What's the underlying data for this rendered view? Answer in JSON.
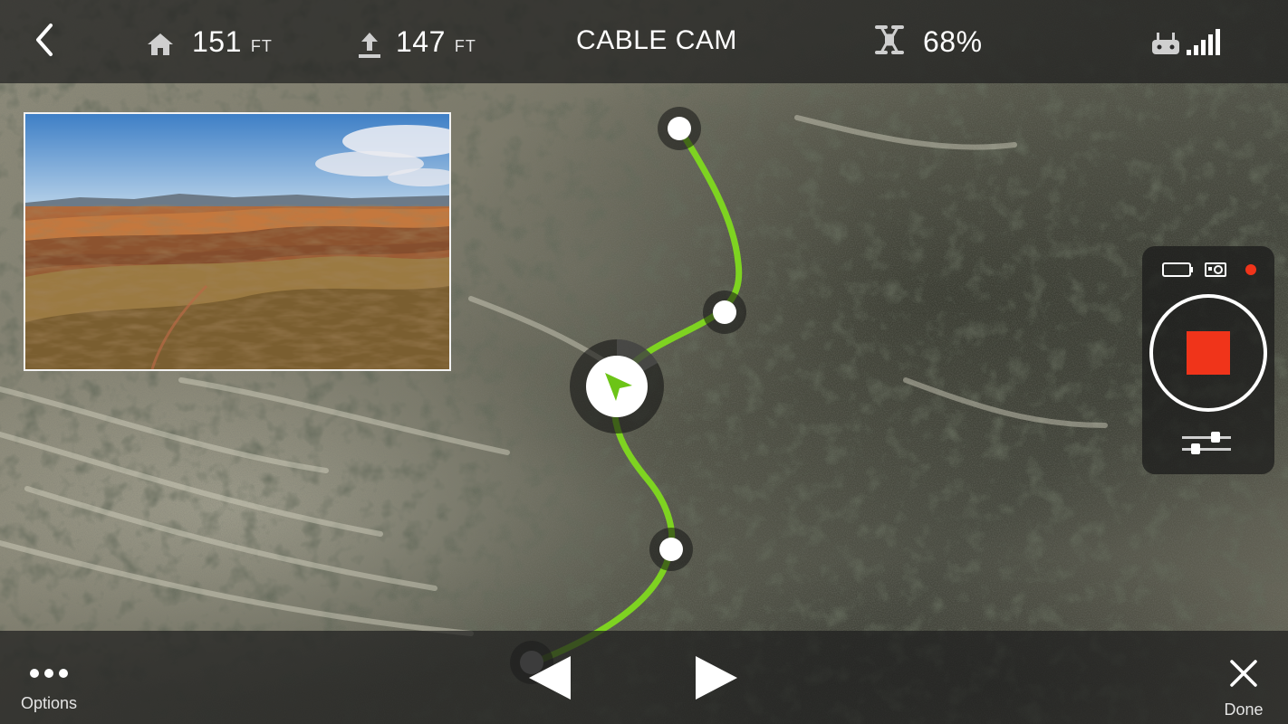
{
  "header": {
    "back_icon": "chevron-left-icon",
    "home_distance": {
      "icon": "home-icon",
      "value": "151",
      "unit": "FT"
    },
    "altitude": {
      "icon": "altitude-up-icon",
      "value": "147",
      "unit": "FT"
    },
    "title": "CABLE CAM",
    "battery": {
      "icon": "drone-icon",
      "value": "68%"
    },
    "signal": {
      "icon": "controller-signal-icon"
    }
  },
  "camera_preview": {
    "icon": "video-preview-thumbnail"
  },
  "flight_path": {
    "path_color": "#7ed321",
    "waypoints": [
      "waypoint-1",
      "waypoint-2",
      "waypoint-3",
      "waypoint-start"
    ],
    "drone_marker_icon": "drone-position-arrow-icon"
  },
  "record_panel": {
    "mode_icons": [
      "phone-icon",
      "camera-icon",
      "recording-dot-icon"
    ],
    "record_state": "recording",
    "stop_color": "#f0341a",
    "settings_icon": "sliders-icon"
  },
  "footer": {
    "options_label": "Options",
    "prev_icon": "triangle-left-icon",
    "next_icon": "triangle-right-icon",
    "done_label": "Done"
  }
}
